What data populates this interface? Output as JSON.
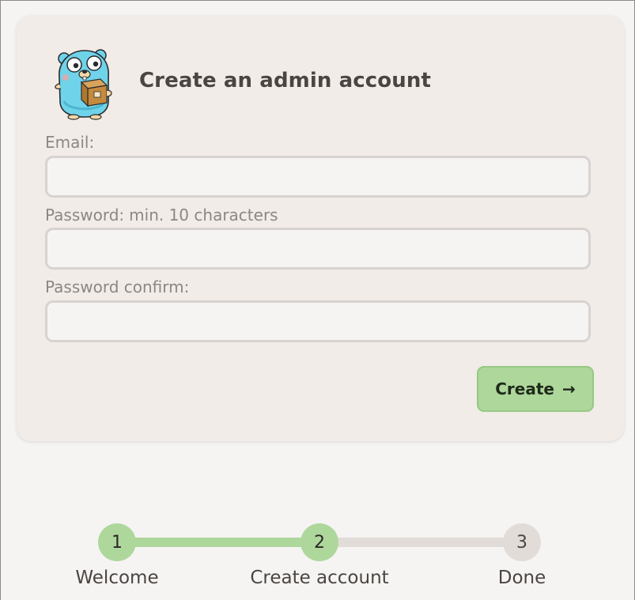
{
  "form": {
    "title": "Create an admin account",
    "logo_icon": "go-gopher-with-box-icon",
    "email": {
      "label": "Email:",
      "value": "",
      "placeholder": ""
    },
    "password": {
      "label": "Password:",
      "hint": "min. 10 characters",
      "value": "",
      "placeholder": ""
    },
    "password_confirm": {
      "label": "Password confirm:",
      "value": "",
      "placeholder": ""
    },
    "submit": {
      "label": "Create",
      "icon": "arrow-right-icon",
      "arrow_glyph": "→"
    }
  },
  "stepper": {
    "current_step": 2,
    "steps": [
      {
        "number": "1",
        "label": "Welcome",
        "state": "complete"
      },
      {
        "number": "2",
        "label": "Create account",
        "state": "current"
      },
      {
        "number": "3",
        "label": "Done",
        "state": "pending"
      }
    ]
  },
  "colors": {
    "page_background": "#f6f4f2",
    "card_background": "#f1ece8",
    "accent_green": "#aed79c",
    "pending_gray": "#e2dcd8",
    "text_dark": "#4a4542",
    "text_muted": "#8d8783"
  }
}
